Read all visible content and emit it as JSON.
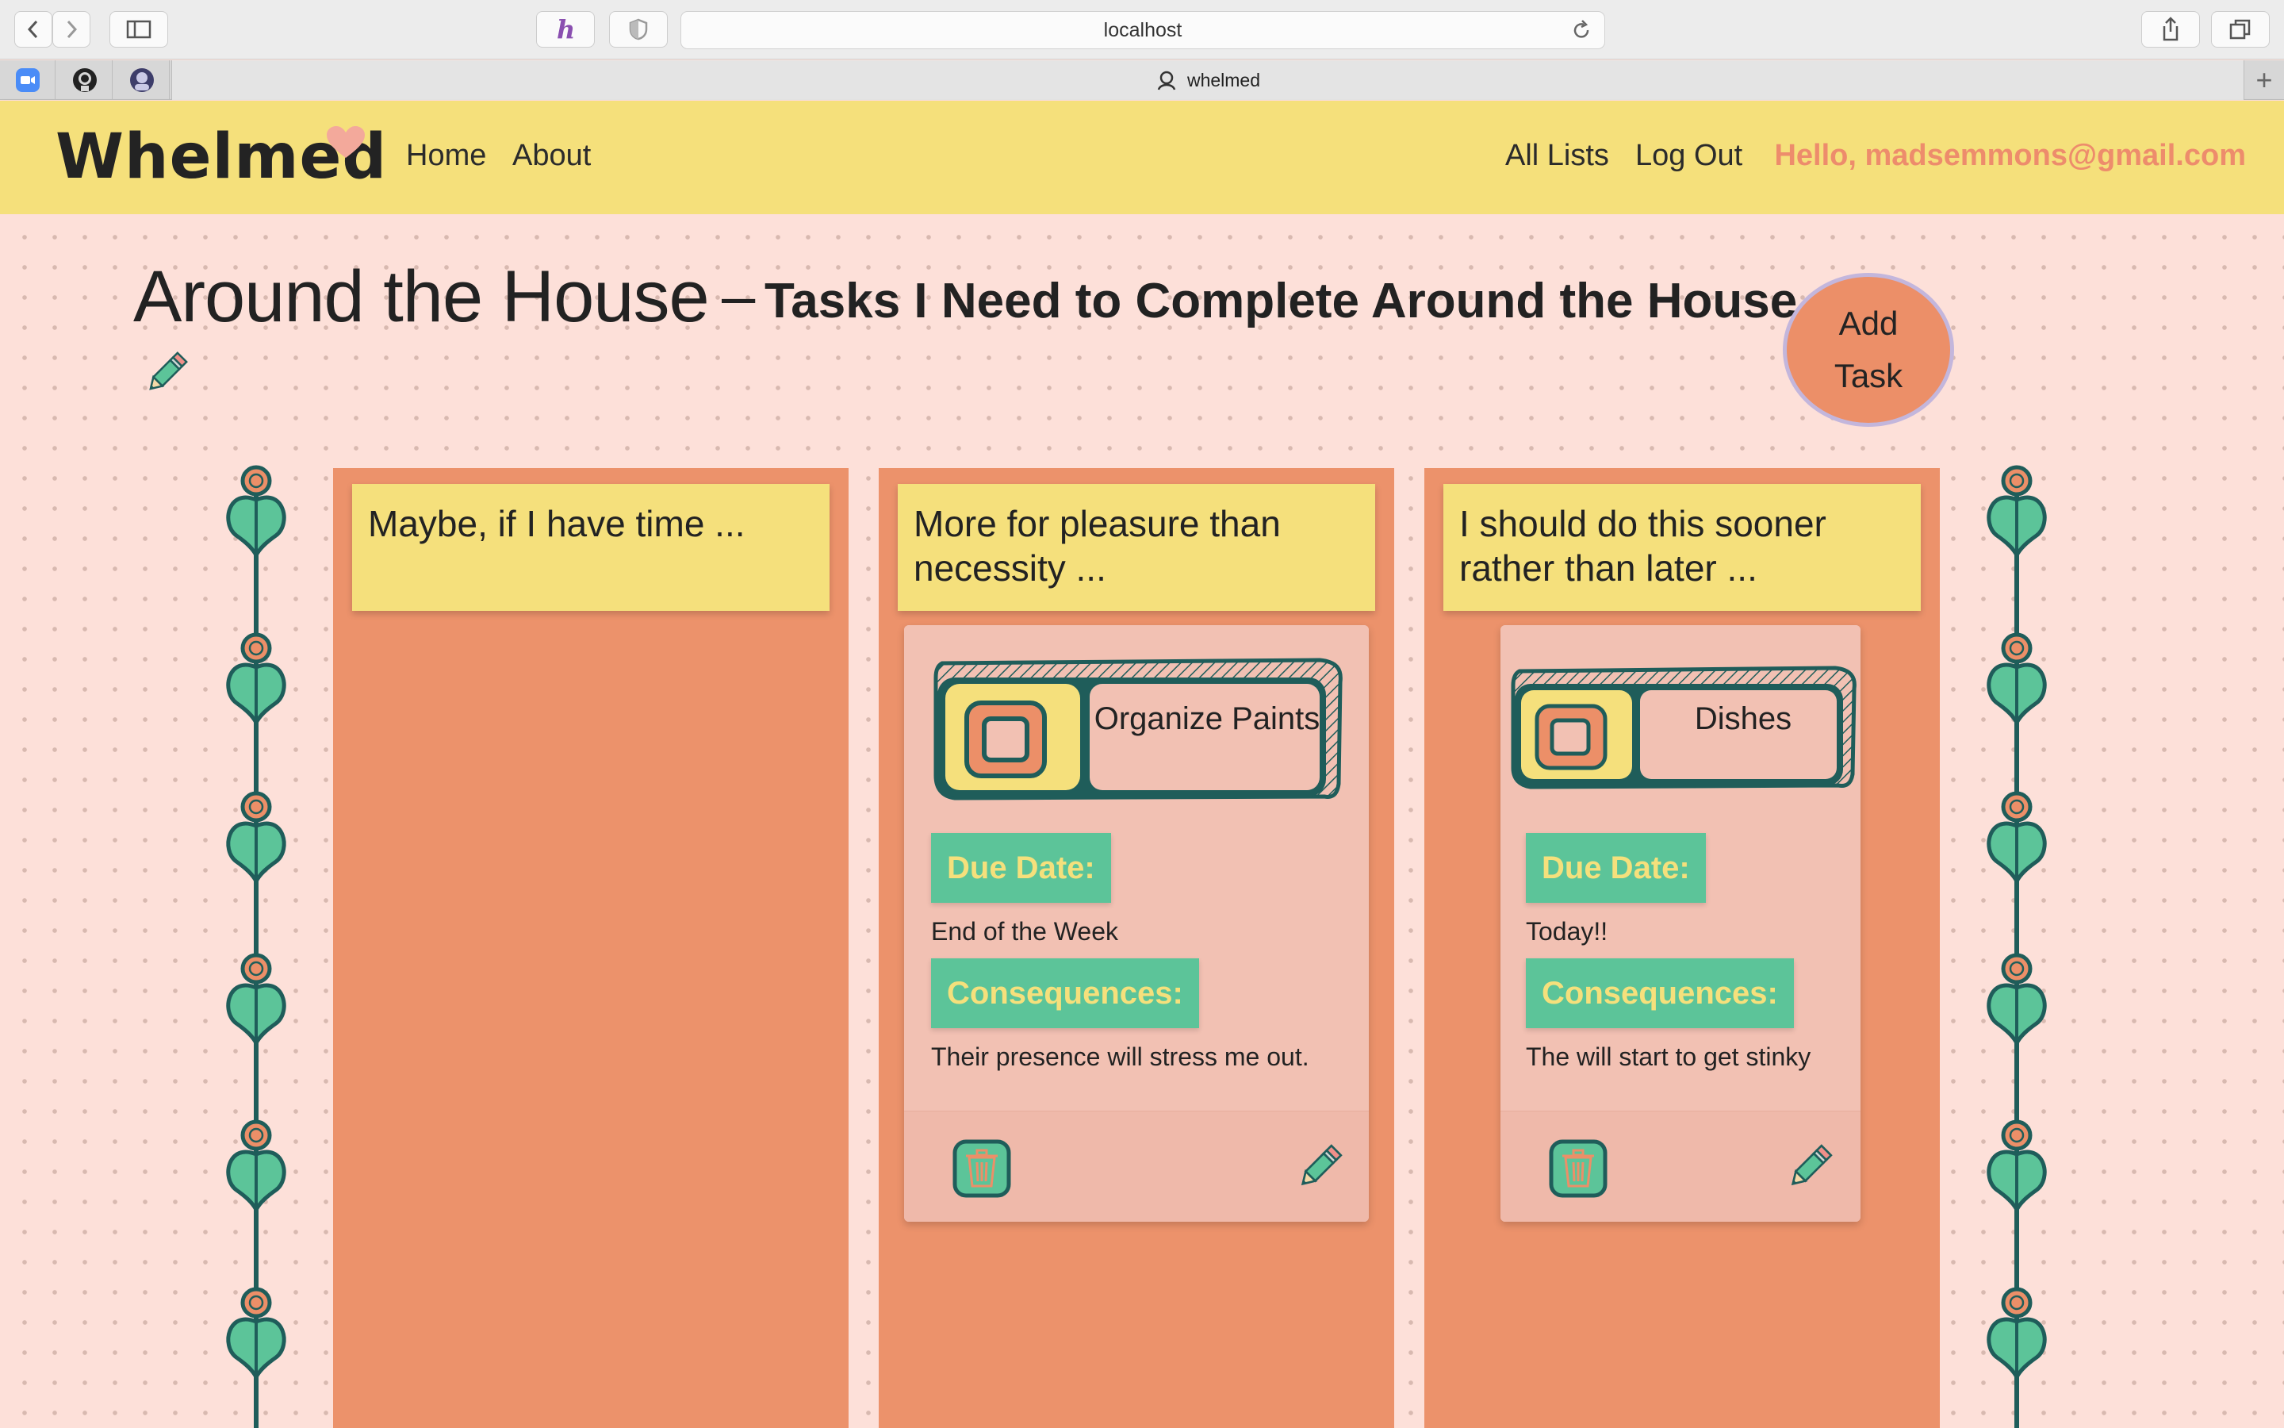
{
  "browser": {
    "url": "localhost",
    "tab_title": "whelmed"
  },
  "nav": {
    "brand": "Whelmed",
    "home": "Home",
    "about": "About",
    "all_lists": "All Lists",
    "logout": "Log Out",
    "greeting": "Hello, madsemmons@gmail.com"
  },
  "list": {
    "title": "Around the House",
    "dash": "–",
    "subtitle": "Tasks I Need to Complete Around the House",
    "add_task": [
      "Add",
      "Task"
    ]
  },
  "columns": [
    {
      "header": "Maybe, if I have time ..."
    },
    {
      "header": "More for pleasure than necessity ..."
    },
    {
      "header": "I should do this sooner rather than later ..."
    }
  ],
  "tasks": [
    {
      "name": "Organize Paints",
      "due_label": "Due Date:",
      "due": "End of the Week",
      "consequences_label": "Consequences:",
      "consequences": "Their presence will stress me out."
    },
    {
      "name": "Dishes",
      "due_label": "Due Date:",
      "due": "Today!!",
      "consequences_label": "Consequences:",
      "consequences": "The will start to get stinky"
    }
  ],
  "colors": {
    "navbar": "#f5e07b",
    "page": "#fde0d9",
    "column": "#ec926b",
    "card": "#f2c1b3",
    "label": "#5cc499",
    "accent": "#ed8c6c",
    "teal": "#1f5d5a"
  },
  "icons": [
    "back-icon",
    "forward-icon",
    "sidebar-icon",
    "extension-h-icon",
    "shield-icon",
    "reload-icon",
    "share-icon",
    "tabs-icon",
    "zoom-icon",
    "github-icon",
    "avatar-icon",
    "heart-icon",
    "pencil-icon",
    "trash-icon",
    "vine-icon"
  ]
}
